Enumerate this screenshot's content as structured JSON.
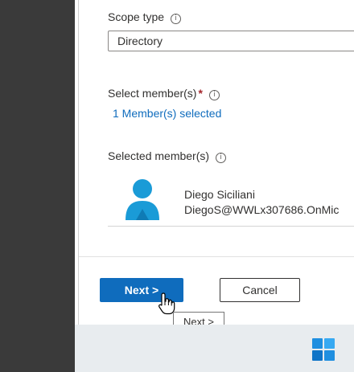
{
  "form": {
    "scope_type_label": "Scope type",
    "scope_type_value": "Directory",
    "select_members_label": "Select member(s)",
    "required_marker": "*",
    "members_selected_link": "1 Member(s) selected",
    "selected_members_label": "Selected member(s)",
    "info_glyph": "i"
  },
  "members": [
    {
      "name": "Diego Siciliani",
      "email": "DiegoS@WWLx307686.OnMic"
    }
  ],
  "footer": {
    "next_label": "Next >",
    "cancel_label": "Cancel"
  },
  "tooltip": {
    "text": "Next >"
  },
  "colors": {
    "accent": "#0f6cbd",
    "required": "#a4262c",
    "avatar": "#1a9bd7"
  },
  "icons": [
    "info-icon",
    "user-avatar-icon",
    "pointer-cursor-icon",
    "windows-start-icon"
  ]
}
